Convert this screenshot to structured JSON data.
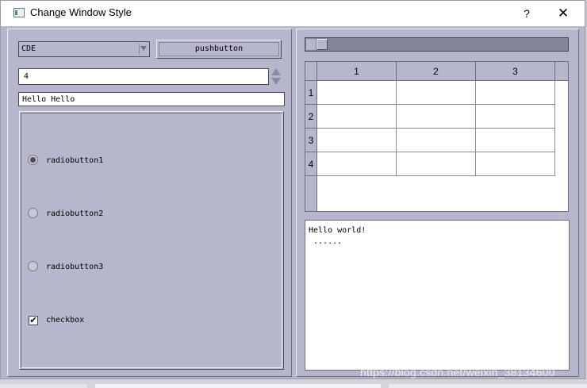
{
  "window": {
    "title": "Change Window Style",
    "help_label": "?",
    "close_label": "✕"
  },
  "left": {
    "combo": {
      "value": "CDE"
    },
    "push_button": {
      "label": "pushbutton"
    },
    "spinbox": {
      "value": "4"
    },
    "line_edit": {
      "value": "Hello Hello"
    },
    "radios": [
      {
        "label": "radiobutton1",
        "checked": true
      },
      {
        "label": "radiobutton2",
        "checked": false
      },
      {
        "label": "radiobutton3",
        "checked": false
      }
    ],
    "checkbox": {
      "label": "checkbox",
      "checked": true,
      "mark": "✔"
    }
  },
  "right": {
    "scrollbar": {
      "value_fraction": 0.0
    },
    "table": {
      "columns": [
        "1",
        "2",
        "3"
      ],
      "rows": [
        "1",
        "2",
        "3",
        "4"
      ]
    },
    "text_edit": {
      "lines": [
        "Hello world!",
        " ......"
      ]
    }
  },
  "watermark": "https://blog.csdn.net/weixin_38134600"
}
